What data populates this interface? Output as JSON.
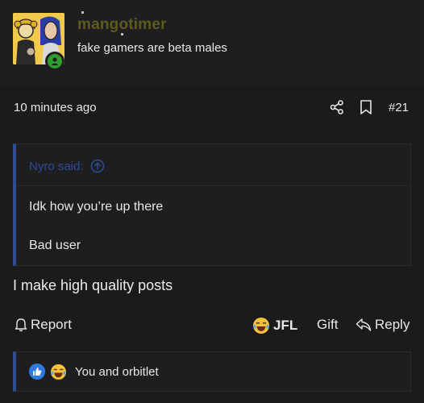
{
  "user": {
    "username": "mangotimer",
    "title": "fake gamers are beta males"
  },
  "post": {
    "timestamp": "10 minutes ago",
    "number": "#21",
    "body": "I make high quality posts"
  },
  "quote": {
    "attribution": "Nyro said:",
    "lines": [
      "Idk how you’re up there",
      "Bad user"
    ]
  },
  "actions": {
    "report": "Report",
    "reaction_label": "JFL",
    "gift": "Gift",
    "reply": "Reply"
  },
  "reactions": {
    "summary": "You and orbitlet"
  },
  "colors": {
    "accent": "#2f4d93",
    "username": "#5f5a1e",
    "online": "#2e9e2e",
    "background": "#1b1b1d"
  }
}
